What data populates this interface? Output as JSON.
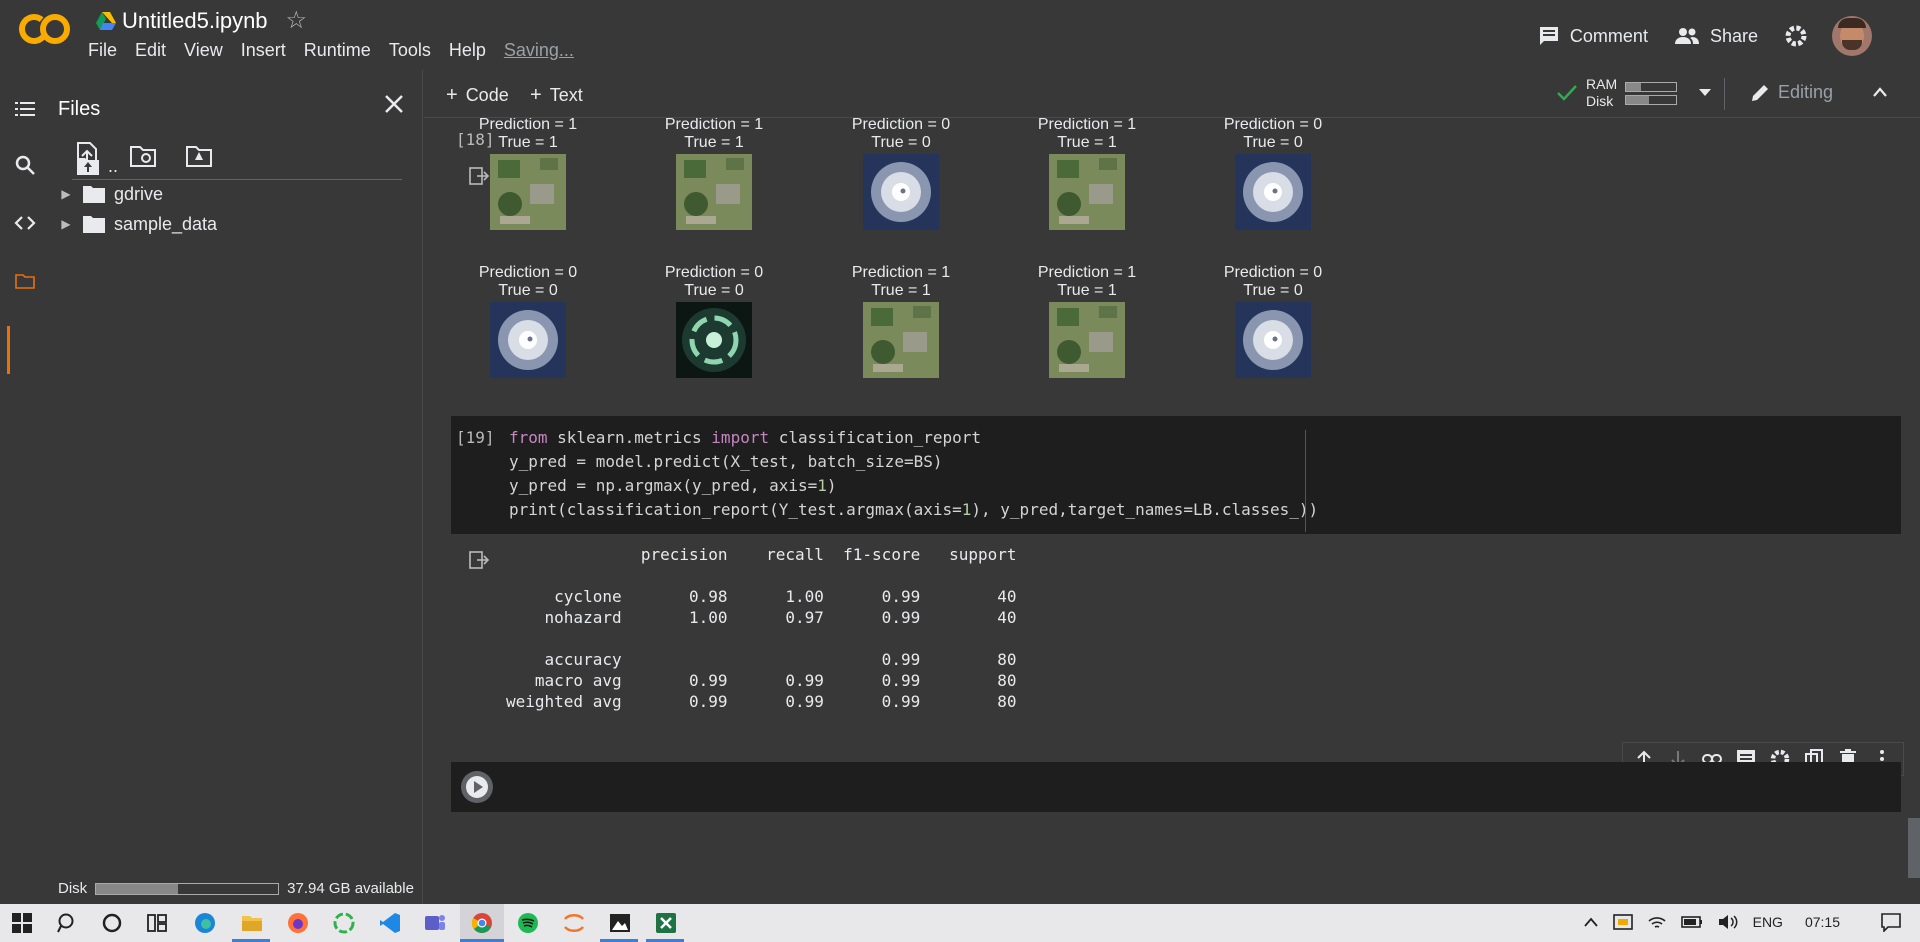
{
  "header": {
    "title": "Untitled5.ipynb",
    "menu": [
      "File",
      "Edit",
      "View",
      "Insert",
      "Runtime",
      "Tools",
      "Help"
    ],
    "saving": "Saving...",
    "comment_label": "Comment",
    "share_label": "Share"
  },
  "sidebar": {
    "title": "Files",
    "tree": [
      {
        "label": "..",
        "type": "parent"
      },
      {
        "label": "gdrive",
        "type": "folder"
      },
      {
        "label": "sample_data",
        "type": "folder"
      }
    ],
    "disk_label": "Disk",
    "disk_available": "37.94 GB available",
    "disk_used_fraction": 0.45
  },
  "toolbar": {
    "add_code": "Code",
    "add_text": "Text",
    "ram_label": "RAM",
    "disk_label": "Disk",
    "ram_fraction": 0.3,
    "disk_fraction": 0.45,
    "editing_label": "Editing"
  },
  "cells": {
    "cell18_count": "[18]",
    "cell19_count": "[19]",
    "predictions": [
      {
        "pred": "Prediction = 1",
        "true": "True = 1",
        "kind": "aerial"
      },
      {
        "pred": "Prediction = 1",
        "true": "True = 1",
        "kind": "aerial"
      },
      {
        "pred": "Prediction = 0",
        "true": "True = 0",
        "kind": "storm"
      },
      {
        "pred": "Prediction = 1",
        "true": "True = 1",
        "kind": "aerial"
      },
      {
        "pred": "Prediction = 0",
        "true": "True = 0",
        "kind": "storm"
      },
      {
        "pred": "Prediction = 0",
        "true": "True = 0",
        "kind": "storm"
      },
      {
        "pred": "Prediction = 0",
        "true": "True = 0",
        "kind": "radar"
      },
      {
        "pred": "Prediction = 1",
        "true": "True = 1",
        "kind": "aerial"
      },
      {
        "pred": "Prediction = 1",
        "true": "True = 1",
        "kind": "aerial"
      },
      {
        "pred": "Prediction = 0",
        "true": "True = 0",
        "kind": "storm"
      }
    ],
    "code": {
      "l1_a": "from",
      "l1_b": " sklearn.metrics ",
      "l1_c": "import",
      "l1_d": " classification_report",
      "l2": "y_pred = model.predict(X_test, batch_size=BS)",
      "l3_a": "y_pred = np.argmax(y_pred, axis=",
      "l3_b": "1",
      "l3_c": ")",
      "l4_a": "print(classification_report(Y_test.argmax(axis=",
      "l4_b": "1",
      "l4_c": "), y_pred,target_names=LB.classes_))"
    },
    "report": [
      "              precision    recall  f1-score   support",
      "",
      "     cyclone       0.98      1.00      0.99        40",
      "    nohazard       1.00      0.97      0.99        40",
      "",
      "    accuracy                           0.99        80",
      "   macro avg       0.99      0.99      0.99        80",
      "weighted avg       0.99      0.99      0.99        80"
    ]
  },
  "taskbar": {
    "lang": "ENG",
    "time": "07:15"
  }
}
